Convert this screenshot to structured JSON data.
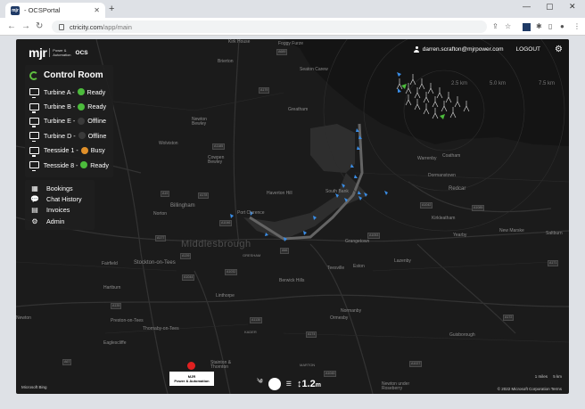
{
  "browser": {
    "tab_title": "- OCSPortal",
    "favicon_text": "mjr",
    "new_tab": "+",
    "url_host": "ctricity.com",
    "url_path": "/app/main",
    "min": "—",
    "max": "▢",
    "close": "✕"
  },
  "header": {
    "logo": "mjr",
    "logo_sub1": "Power &",
    "logo_sub2": "Automation",
    "product": "OCS",
    "email": "darren.scrafton@mjrpower.com",
    "logout": "LOGOUT"
  },
  "control_room": {
    "title": "Control Room",
    "items": [
      {
        "name": "Turbine A -",
        "status": "Ready",
        "color": "#4cbb3c"
      },
      {
        "name": "Turbine B -",
        "status": "Ready",
        "color": "#4cbb3c"
      },
      {
        "name": "Turbine E -",
        "status": "Offline",
        "color": "#3a3a3a"
      },
      {
        "name": "Turbine D -",
        "status": "Offline",
        "color": "#3a3a3a"
      },
      {
        "name": "Teesside 1 -",
        "status": "Busy",
        "color": "#e0902a"
      },
      {
        "name": "Teesside 8 -",
        "status": "Ready",
        "color": "#4cbb3c"
      }
    ]
  },
  "menu": {
    "items": [
      {
        "label": "Bookings",
        "icon": "calendar-icon"
      },
      {
        "label": "Chat History",
        "icon": "chat-icon"
      },
      {
        "label": "Invoices",
        "icon": "document-icon"
      },
      {
        "label": "Admin",
        "icon": "gear-icon"
      }
    ]
  },
  "map": {
    "rings": [
      "2.5 km",
      "5.0 km",
      "7.5 km"
    ],
    "labels": [
      {
        "t": "Kirk House"
      },
      {
        "t": "Seaton Carew"
      },
      {
        "t": "Greatham"
      },
      {
        "t": "Newton Bewley"
      },
      {
        "t": "Wolviston"
      },
      {
        "t": "Cowpen Bewley"
      },
      {
        "t": "Billingham"
      },
      {
        "t": "Haverton Hill"
      },
      {
        "t": "South Bank"
      },
      {
        "t": "Norton"
      },
      {
        "t": "Port Clarence"
      },
      {
        "t": "Middlesbrough"
      },
      {
        "t": "Stockton-on-Tees"
      },
      {
        "t": "Fairfield"
      },
      {
        "t": "Hartburn"
      },
      {
        "t": "Linthorpe"
      },
      {
        "t": "Berwick Hills"
      },
      {
        "t": "Teesville"
      },
      {
        "t": "Eston"
      },
      {
        "t": "Lazenby"
      },
      {
        "t": "Grangetown"
      },
      {
        "t": "Warrenby"
      },
      {
        "t": "Coatham"
      },
      {
        "t": "Dormanstown"
      },
      {
        "t": "Redcar"
      },
      {
        "t": "Kirkleatham"
      },
      {
        "t": "Yearby"
      },
      {
        "t": "New Marske"
      },
      {
        "t": "Saltburn"
      },
      {
        "t": "Normanby"
      },
      {
        "t": "Ormesby"
      },
      {
        "t": "Thornaby-on-Tees"
      },
      {
        "t": "Preston-on-Tees"
      },
      {
        "t": "Eaglescliffe"
      },
      {
        "t": "Newton"
      },
      {
        "t": "Stainton & Thornton"
      },
      {
        "t": "Guisborough"
      },
      {
        "t": "Newton under Roseberry"
      },
      {
        "t": "GRESHAM"
      },
      {
        "t": "MARTON"
      },
      {
        "t": "KADER"
      },
      {
        "t": "Brierton"
      },
      {
        "t": "Foggy Furze"
      }
    ],
    "roads": [
      "A689",
      "A179",
      "A1185",
      "A19",
      "A178",
      "A1046",
      "A66",
      "A1032",
      "A1053",
      "A174",
      "A171",
      "A172",
      "A1042",
      "A1085",
      "A135",
      "A67",
      "A1044",
      "A177",
      "A139",
      "A1130",
      "A1027",
      "A1045",
      "A175",
      "A173",
      "A1130",
      "A1085",
      "A1032"
    ],
    "title_big": "Middlesbrough"
  },
  "footer": {
    "pin_line1": "MJR",
    "pin_line2": "Power & Automation",
    "speed": "1.2",
    "speed_unit": "m",
    "ms_logo": "Microsoft Bing",
    "copyright": "© 2022 Microsoft Corporation Terms",
    "scale_left": "1 miles",
    "scale_right": "5 km"
  }
}
